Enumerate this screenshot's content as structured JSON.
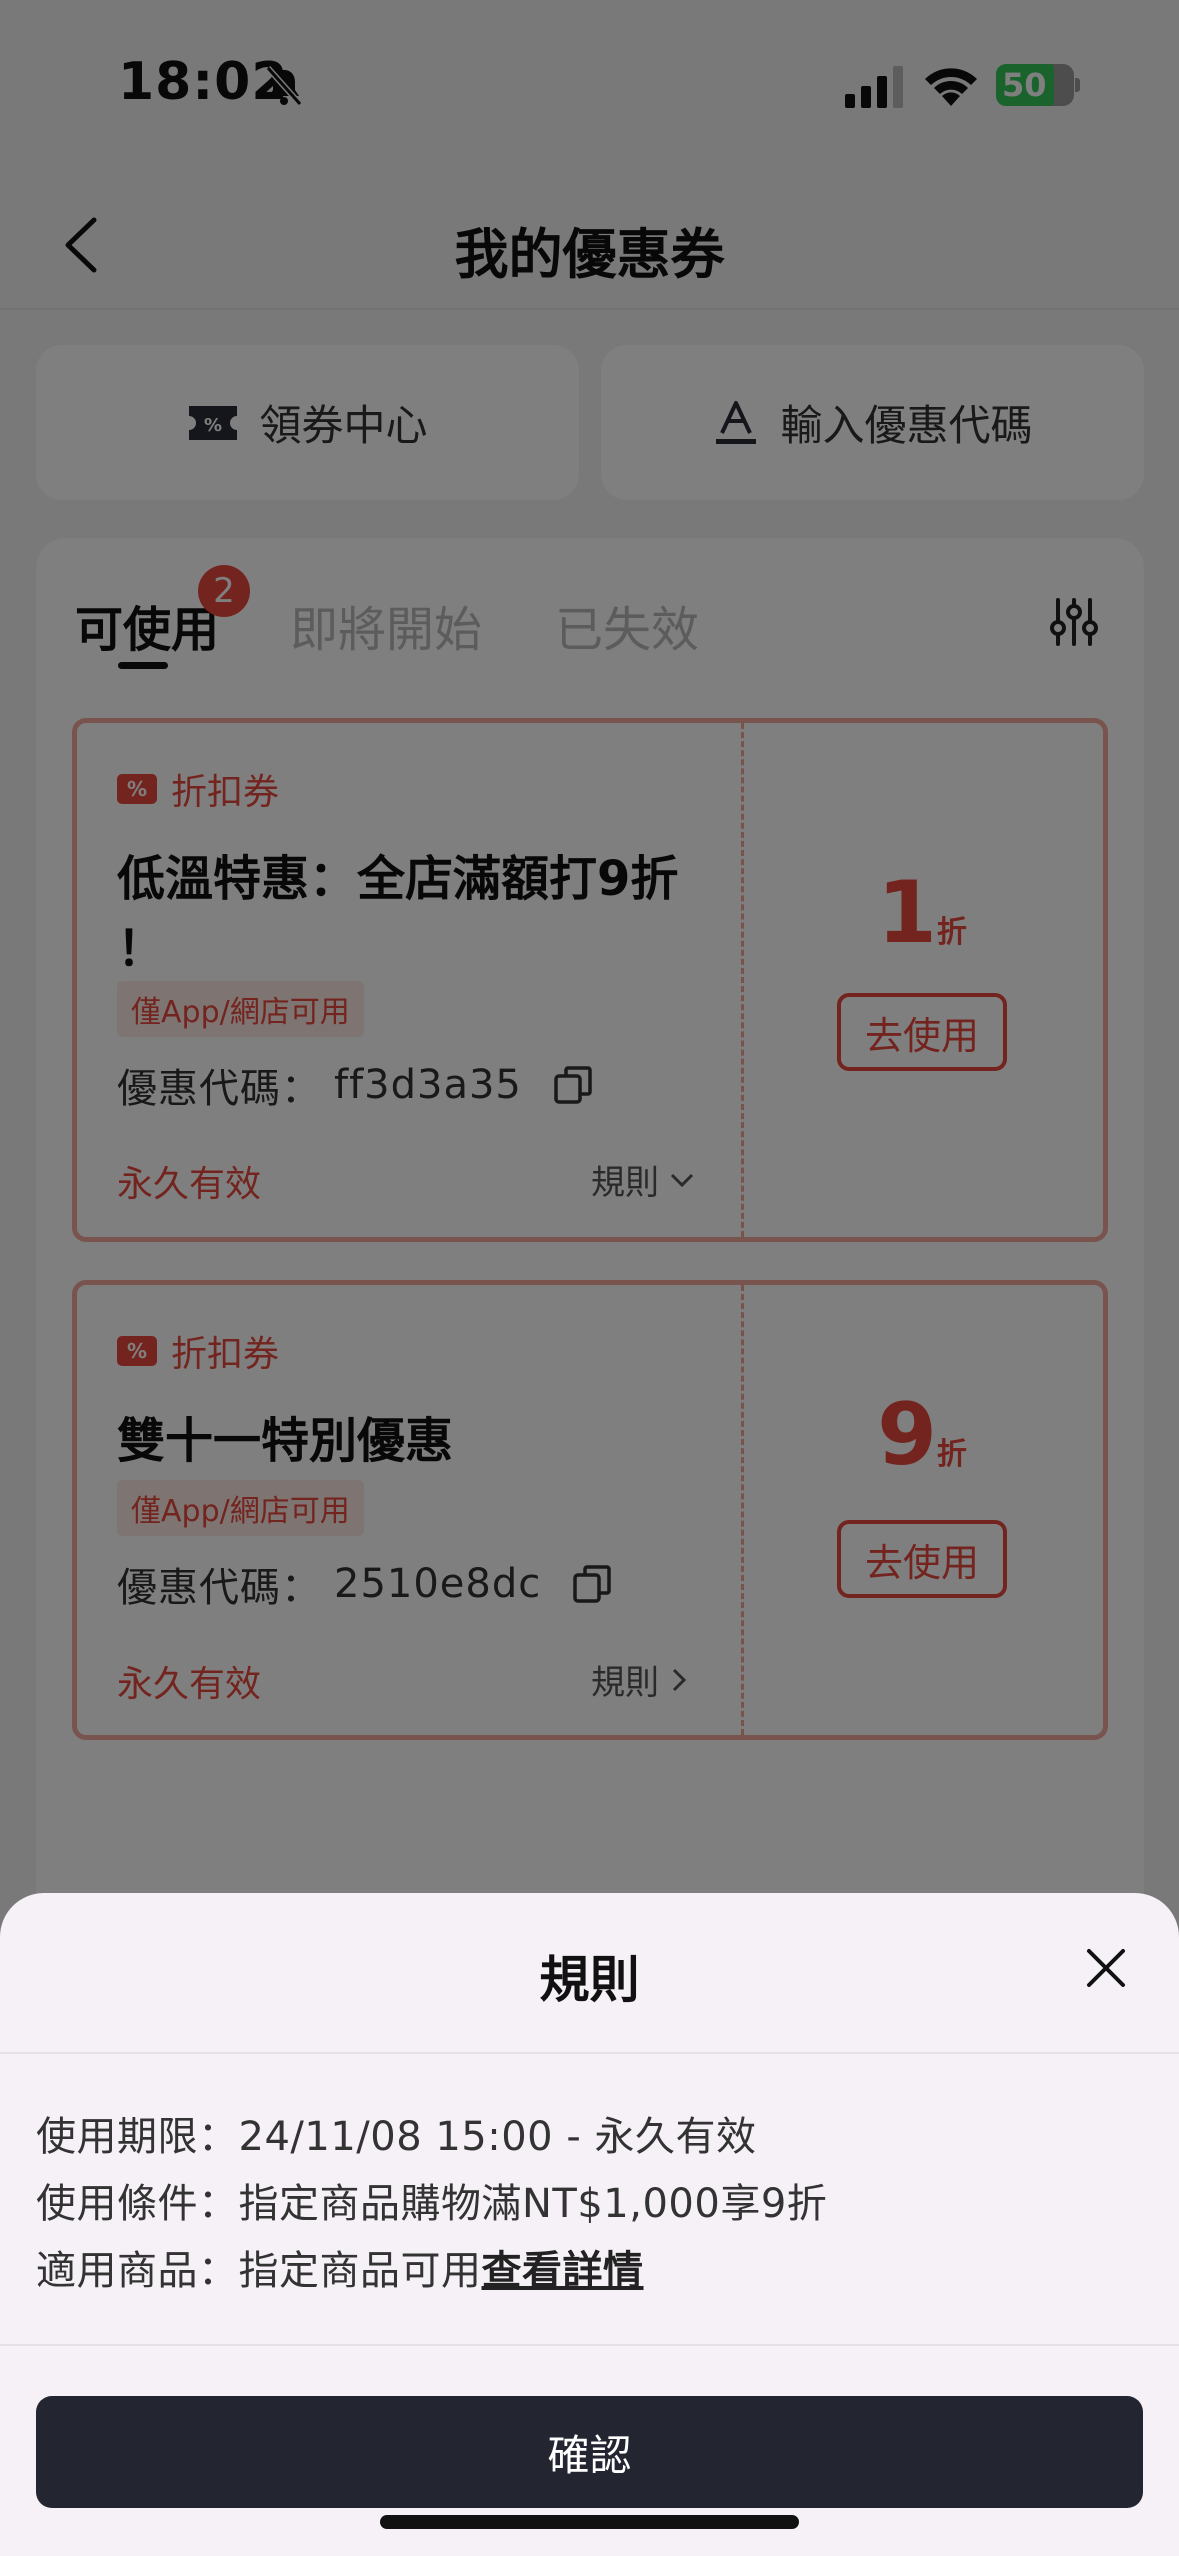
{
  "status_bar": {
    "time": "18:02",
    "battery": "50"
  },
  "header": {
    "title": "我的優惠券"
  },
  "actions": {
    "coupon_center": "領券中心",
    "enter_code": "輸入優惠代碼"
  },
  "tabs": {
    "available": "可使用",
    "available_badge": "2",
    "upcoming": "即將開始",
    "expired": "已失效"
  },
  "coupons": [
    {
      "type": "折扣券",
      "name_line1": "低溫特惠：全店滿額打9折",
      "name_line2": "！",
      "availability": "僅App/網店可用",
      "code_label": "優惠代碼：",
      "code": "ff3d3a35",
      "validity": "永久有效",
      "rules_label": "規則",
      "discount": "1",
      "discount_unit": "折",
      "use_label": "去使用"
    },
    {
      "type": "折扣券",
      "name_line1": "雙十一特別優惠",
      "availability": "僅App/網店可用",
      "code_label": "優惠代碼：",
      "code": "2510e8dc",
      "validity": "永久有效",
      "rules_label": "規則",
      "discount": "9",
      "discount_unit": "折",
      "use_label": "去使用"
    }
  ],
  "sheet": {
    "title": "規則",
    "period": "使用期限：24/11/08 15:00 - 永久有效",
    "condition": "使用條件：指定商品購物滿NT$1,000享9折",
    "products_prefix": "適用商品：指定商品可用",
    "products_link": "查看詳情",
    "confirm": "確認"
  },
  "colors": {
    "accent": "#e8493f",
    "dark_button": "#232630"
  }
}
